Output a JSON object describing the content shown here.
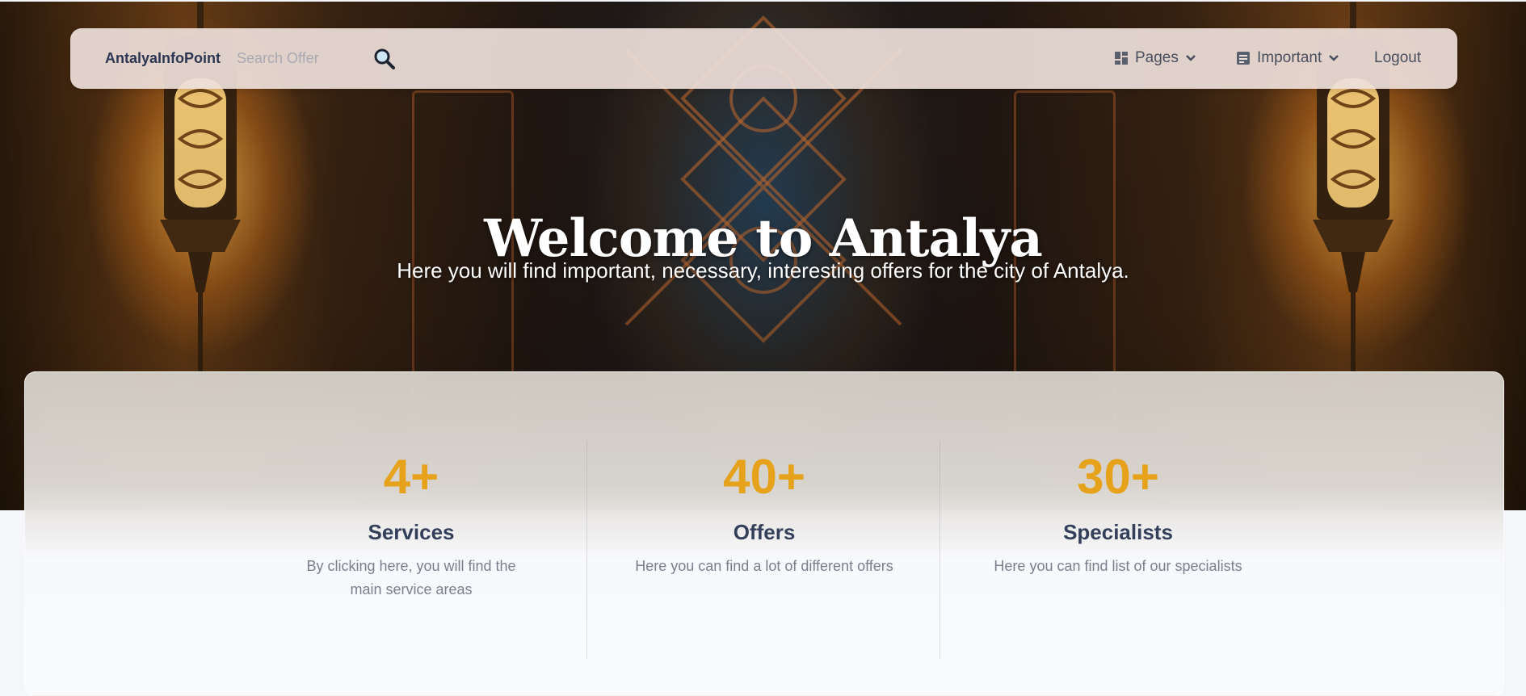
{
  "navbar": {
    "brand": "AntalyaInfoPoint",
    "search_placeholder": "Search Offer",
    "search_icon": "magnifier-icon",
    "pages_label": "Pages",
    "important_label": "Important",
    "logout_label": "Logout"
  },
  "hero": {
    "title": "Welcome to Antalya",
    "subtitle": "Here you will find important, necessary, interesting offers for the city of Antalya."
  },
  "stats": [
    {
      "number": "4+",
      "label": "Services",
      "description": "By clicking here, you will find the main service areas"
    },
    {
      "number": "40+",
      "label": "Offers",
      "description": "Here you can find a lot of different offers"
    },
    {
      "number": "30+",
      "label": "Specialists",
      "description": "Here you can find list of our specialists"
    }
  ],
  "colors": {
    "accent": "#e5a21a",
    "heading": "#34405a",
    "brand_text": "#2c3552"
  }
}
